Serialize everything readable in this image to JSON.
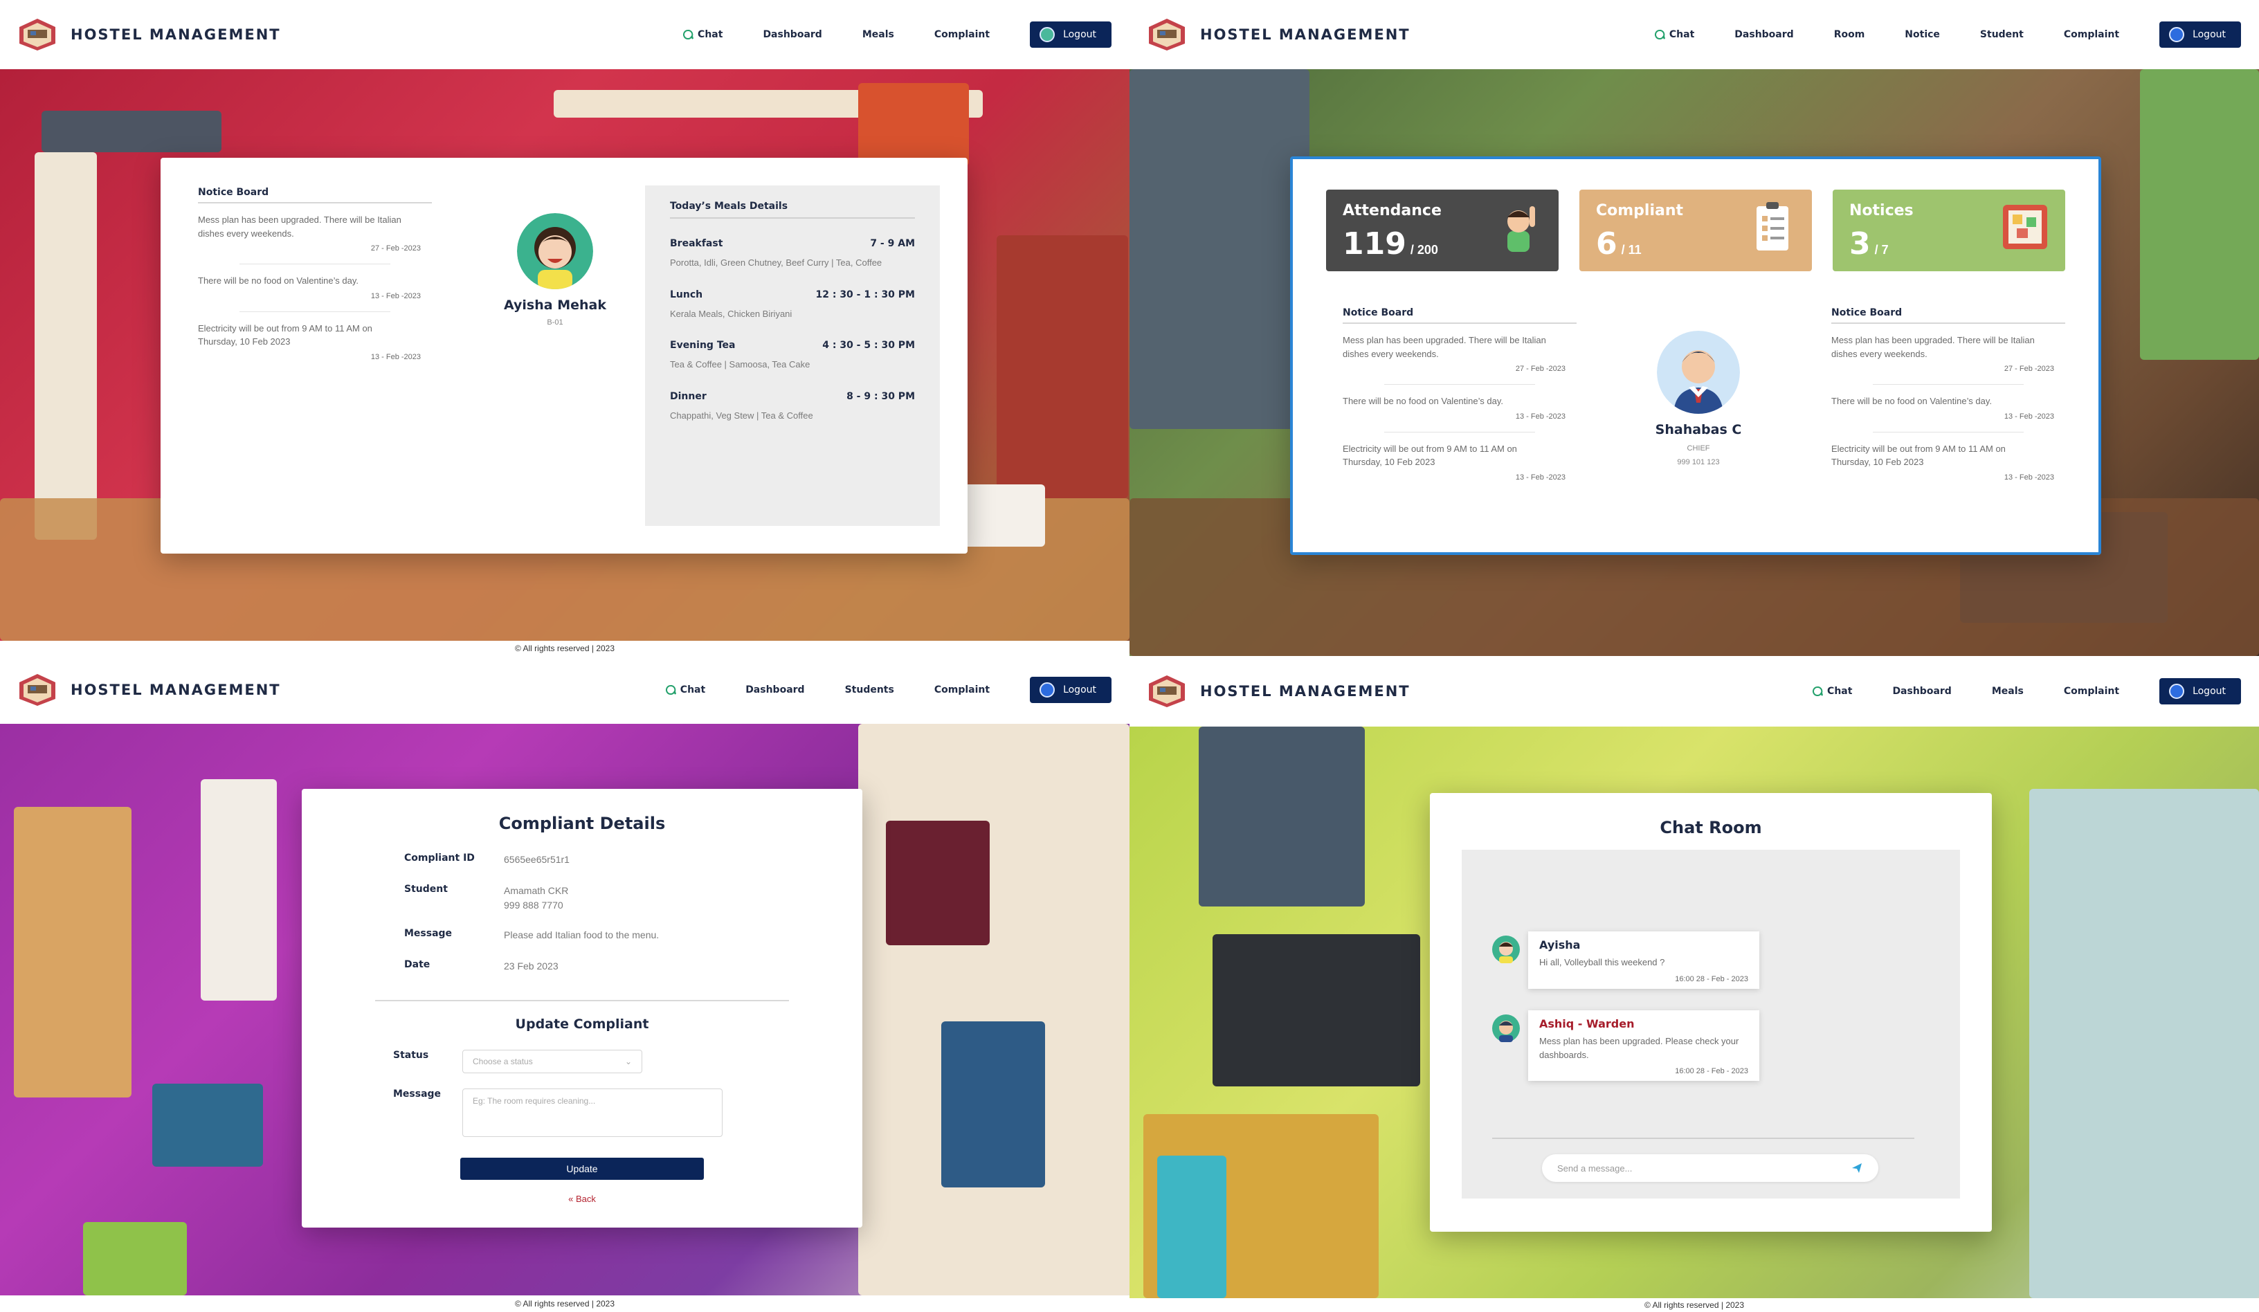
{
  "app": {
    "title": "HOSTEL MANAGEMENT",
    "footer": "© All rights reserved | 2023",
    "colors": {
      "navy": "#0b2559",
      "warden": "#a61d2b"
    }
  },
  "student_dashboard": {
    "nav": {
      "chat": "Chat",
      "dashboard": "Dashboard",
      "meals": "Meals",
      "complaint": "Complaint",
      "logout": "Logout"
    },
    "notice_board": {
      "title": "Notice Board",
      "items": [
        {
          "text": "Mess plan has been upgraded. There will be Italian dishes every weekends.",
          "date": "27 - Feb -2023"
        },
        {
          "text": "There will be no food on Valentine’s day.",
          "date": "13 - Feb -2023"
        },
        {
          "text": "Electricity will be out from 9 AM to 11 AM on Thursday, 10 Feb 2023",
          "date": "13 - Feb -2023"
        }
      ]
    },
    "profile": {
      "name": "Ayisha Mehak",
      "room": "B-01"
    },
    "meals": {
      "title": "Today’s Meals Details",
      "items": [
        {
          "name": "Breakfast",
          "time": "7 - 9 AM",
          "menu": "Porotta, Idli, Green Chutney, Beef Curry | Tea, Coffee"
        },
        {
          "name": "Lunch",
          "time": "12 : 30 - 1 : 30 PM",
          "menu": "Kerala Meals, Chicken Biriyani"
        },
        {
          "name": "Evening Tea",
          "time": "4 : 30 - 5 : 30 PM",
          "menu": "Tea & Coffee | Samoosa, Tea Cake"
        },
        {
          "name": "Dinner",
          "time": "8 - 9 : 30 PM",
          "menu": "Chappathi, Veg Stew | Tea & Coffee"
        }
      ]
    }
  },
  "chief_dashboard": {
    "nav": {
      "chat": "Chat",
      "dashboard": "Dashboard",
      "room": "Room",
      "notice": "Notice",
      "student": "Student",
      "complaint": "Complaint",
      "logout": "Logout"
    },
    "stats": {
      "attendance": {
        "label": "Attendance",
        "value": "119",
        "total": "/ 200",
        "color": "#4a4a4a"
      },
      "compliant": {
        "label": "Compliant",
        "value": "6",
        "total": "/ 11",
        "color": "#e0b27e"
      },
      "notices": {
        "label": "Notices",
        "value": "3",
        "total": "/ 7",
        "color": "#9ec46e"
      }
    },
    "notice_board_left": {
      "title": "Notice Board",
      "items": [
        {
          "text": "Mess plan has been upgraded. There will be Italian dishes every weekends.",
          "date": "27 - Feb -2023"
        },
        {
          "text": "There will be no food on Valentine’s day.",
          "date": "13 - Feb -2023"
        },
        {
          "text": "Electricity will be out from 9 AM to 11 AM on Thursday, 10 Feb 2023",
          "date": "13 - Feb -2023"
        }
      ]
    },
    "notice_board_right": {
      "title": "Notice Board",
      "items": [
        {
          "text": "Mess plan has been upgraded. There will be Italian dishes every weekends.",
          "date": "27 - Feb -2023"
        },
        {
          "text": "There will be no food on Valentine’s day.",
          "date": "13 - Feb -2023"
        },
        {
          "text": "Electricity will be out from 9 AM to 11 AM on Thursday, 10 Feb 2023",
          "date": "13 - Feb -2023"
        }
      ]
    },
    "profile": {
      "name": "Shahabas C",
      "role": "CHIEF",
      "phone": "999 101 123"
    }
  },
  "complaint_page": {
    "nav": {
      "chat": "Chat",
      "dashboard": "Dashboard",
      "students": "Students",
      "complaint": "Complaint",
      "logout": "Logout"
    },
    "title": "Compliant Details",
    "details": {
      "id_label": "Compliant ID",
      "id_value": "6565ee65r51r1",
      "student_label": "Student",
      "student_name": "Amamath CKR",
      "student_phone": "999 888 7770",
      "message_label": "Message",
      "message_value": "Please add Italian food to the menu.",
      "date_label": "Date",
      "date_value": "23 Feb 2023"
    },
    "update": {
      "title": "Update Compliant",
      "status_label": "Status",
      "status_placeholder": "Choose a status",
      "message_label": "Message",
      "message_placeholder": "Eg: The room requires cleaning...",
      "button": "Update",
      "back": "« Back"
    }
  },
  "chat_page": {
    "nav": {
      "chat": "Chat",
      "dashboard": "Dashboard",
      "meals": "Meals",
      "complaint": "Complaint",
      "logout": "Logout"
    },
    "title": "Chat Room",
    "messages": [
      {
        "author": "Ayisha",
        "text": "Hi all, Volleyball this weekend ?",
        "time": "16:00 28 - Feb - 2023"
      },
      {
        "author": "Ashiq - Warden",
        "text": "Mess plan has been upgraded. Please check your dashboards.",
        "time": "16:00 28 - Feb - 2023"
      }
    ],
    "input_placeholder": "Send a message..."
  }
}
